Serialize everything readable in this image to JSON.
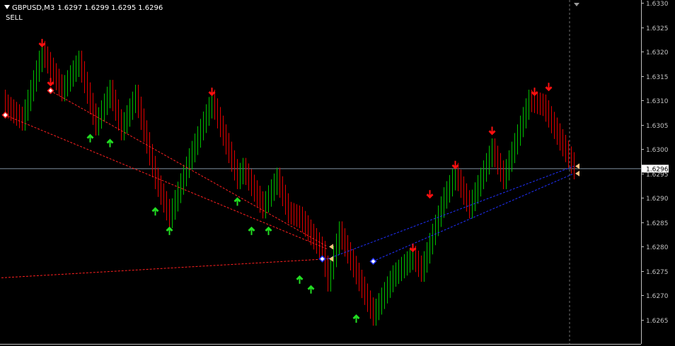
{
  "header": {
    "symbol_tf": "GBPUSD,M3",
    "open": "1.6297",
    "high": "1.6299",
    "low": "1.6295",
    "close": "1.6296"
  },
  "signal_label": "SELL",
  "current_price_label": "1.6296",
  "colors": {
    "background": "#000000",
    "up_bar": "#00c000",
    "down_bar": "#e00000",
    "up_arrow": "#22dd22",
    "down_arrow": "#ff1010",
    "axis": "#c0c0c0",
    "price_line": "#8090a0",
    "red_trend": "#ff2020",
    "blue_trend": "#2030ff",
    "marker_orange": "#ffc080"
  },
  "chart_data": {
    "type": "bar",
    "ylim": [
      1.62615,
      1.63305
    ],
    "yticks": [
      "1.6330",
      "1.6325",
      "1.6320",
      "1.6315",
      "1.6310",
      "1.6305",
      "1.6300",
      "1.6295",
      "1.6290",
      "1.6285",
      "1.6280",
      "1.6275",
      "1.6270",
      "1.6265"
    ],
    "current_price": 1.6296,
    "bar_count": 202,
    "path_points": [
      [
        0,
        1.6309
      ],
      [
        6,
        1.6306
      ],
      [
        13,
        1.632
      ],
      [
        20,
        1.6312
      ],
      [
        26,
        1.6318
      ],
      [
        32,
        1.6305
      ],
      [
        37,
        1.6312
      ],
      [
        41,
        1.6304
      ],
      [
        46,
        1.6311
      ],
      [
        53,
        1.6294
      ],
      [
        58,
        1.6286
      ],
      [
        65,
        1.6298
      ],
      [
        73,
        1.631
      ],
      [
        82,
        1.6294
      ],
      [
        84,
        1.6296
      ],
      [
        91,
        1.6288
      ],
      [
        96,
        1.6294
      ],
      [
        100,
        1.6287
      ],
      [
        104,
        1.6286
      ],
      [
        112,
        1.6279
      ],
      [
        114,
        1.6273
      ],
      [
        118,
        1.6283
      ],
      [
        130,
        1.6266
      ],
      [
        137,
        1.6274
      ],
      [
        144,
        1.6278
      ],
      [
        147,
        1.6275
      ],
      [
        155,
        1.629
      ],
      [
        159,
        1.6295
      ],
      [
        164,
        1.6288
      ],
      [
        172,
        1.63
      ],
      [
        176,
        1.6294
      ],
      [
        185,
        1.631
      ],
      [
        190,
        1.6309
      ],
      [
        201,
        1.6296
      ]
    ],
    "down_arrows": [
      [
        13,
        1.632
      ],
      [
        16,
        1.6312
      ],
      [
        73,
        1.631
      ],
      [
        144,
        1.6278
      ],
      [
        150,
        1.6289
      ],
      [
        159,
        1.6295
      ],
      [
        172,
        1.6302
      ],
      [
        187,
        1.631
      ],
      [
        192,
        1.6311
      ]
    ],
    "up_arrows": [
      [
        30,
        1.6304
      ],
      [
        37,
        1.6303
      ],
      [
        53,
        1.6289
      ],
      [
        58,
        1.6285
      ],
      [
        82,
        1.6291
      ],
      [
        87,
        1.6285
      ],
      [
        93,
        1.6285
      ],
      [
        104,
        1.6275
      ],
      [
        108,
        1.6273
      ],
      [
        124,
        1.6267
      ]
    ],
    "trendlines": [
      {
        "color": "red",
        "from": [
          0,
          1.6307
        ],
        "to": [
          114,
          1.62795
        ]
      },
      {
        "color": "red",
        "from": [
          16,
          1.6312
        ],
        "to": [
          114,
          1.628
        ]
      },
      {
        "color": "red",
        "from": [
          -5,
          1.62735
        ],
        "to": [
          114,
          1.62775
        ]
      },
      {
        "color": "blue",
        "from": [
          114,
          1.62775
        ],
        "to": [
          201,
          1.62965
        ]
      },
      {
        "color": "blue",
        "from": [
          130,
          1.6277
        ],
        "to": [
          201,
          1.6295
        ]
      }
    ],
    "diamonds": [
      {
        "x": 0,
        "y": 1.6307,
        "color": "red"
      },
      {
        "x": 16,
        "y": 1.6312,
        "color": "red"
      },
      {
        "x": 112,
        "y": 1.62775,
        "color": "blue"
      },
      {
        "x": 130,
        "y": 1.6277,
        "color": "blue"
      }
    ],
    "flags": [
      {
        "x": 114,
        "y": 1.628
      },
      {
        "x": 114,
        "y": 1.62775
      },
      {
        "x": 201,
        "y": 1.62965
      },
      {
        "x": 201,
        "y": 1.6295
      }
    ]
  }
}
